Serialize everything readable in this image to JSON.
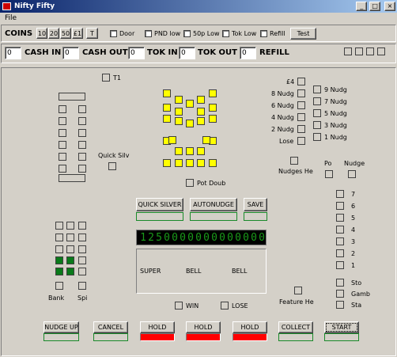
{
  "window": {
    "title": "Nifty Fifty",
    "min": "_",
    "max": "□",
    "close": "×"
  },
  "menu": {
    "file": "File"
  },
  "coins": {
    "label": "COINS",
    "buttons": [
      "10",
      "20",
      "50",
      "£1",
      "T"
    ]
  },
  "options": [
    "Door",
    "PND low",
    "50p Low",
    "Tok Low",
    "Refill"
  ],
  "test_label": "Test",
  "counters": {
    "cash_in": {
      "label": "CASH IN",
      "value": "0"
    },
    "cash_out": {
      "label": "CASH OUT",
      "value": "0"
    },
    "tok_in": {
      "label": "TOK IN",
      "value": "0"
    },
    "tok_out": {
      "label": "TOK OUT",
      "value": "0"
    },
    "refill": {
      "label": "REFILL",
      "value": "0"
    }
  },
  "labels": {
    "t1": "T1",
    "quick_silver": "Quick Silv",
    "pot_double": "Pot Doub",
    "nudges_held": "Nudges He",
    "po": "Po",
    "nudge": "Nudge",
    "feature_held": "Feature He",
    "win": "WIN",
    "lose": "LOSE",
    "bank": "Bank",
    "spin": "Spi"
  },
  "nudge_left": [
    "£4",
    "8 Nudg",
    "6 Nudg",
    "4 Nudg",
    "2 Nudg",
    "Lose"
  ],
  "nudge_right": [
    "9 Nudg",
    "7 Nudg",
    "5 Nudg",
    "3 Nudg",
    "1 Nudg"
  ],
  "right_col": [
    "7",
    "6",
    "5",
    "4",
    "3",
    "2",
    "1"
  ],
  "right_bottom": [
    "Sto",
    "Gamb",
    "Sta"
  ],
  "mid_buttons": {
    "quick_silver": "QUICK SILVER",
    "autonudge": "AUTONUDGE",
    "save": "SAVE"
  },
  "led": {
    "text": "1250000000000000",
    "color": "#1a9a1a"
  },
  "reels": [
    "SUPER",
    "BELL",
    "BELL"
  ],
  "bottom_buttons": {
    "nudge_up": "NUDGE UP",
    "cancel": "CANCEL",
    "hold1": "HOLD",
    "hold2": "HOLD",
    "hold3": "HOLD",
    "collect": "COLLECT",
    "start": "START"
  },
  "colors": {
    "lamp_on": "#ffff00",
    "lamp_green": "#0a7a1a",
    "hold_red": "#ff0000"
  }
}
